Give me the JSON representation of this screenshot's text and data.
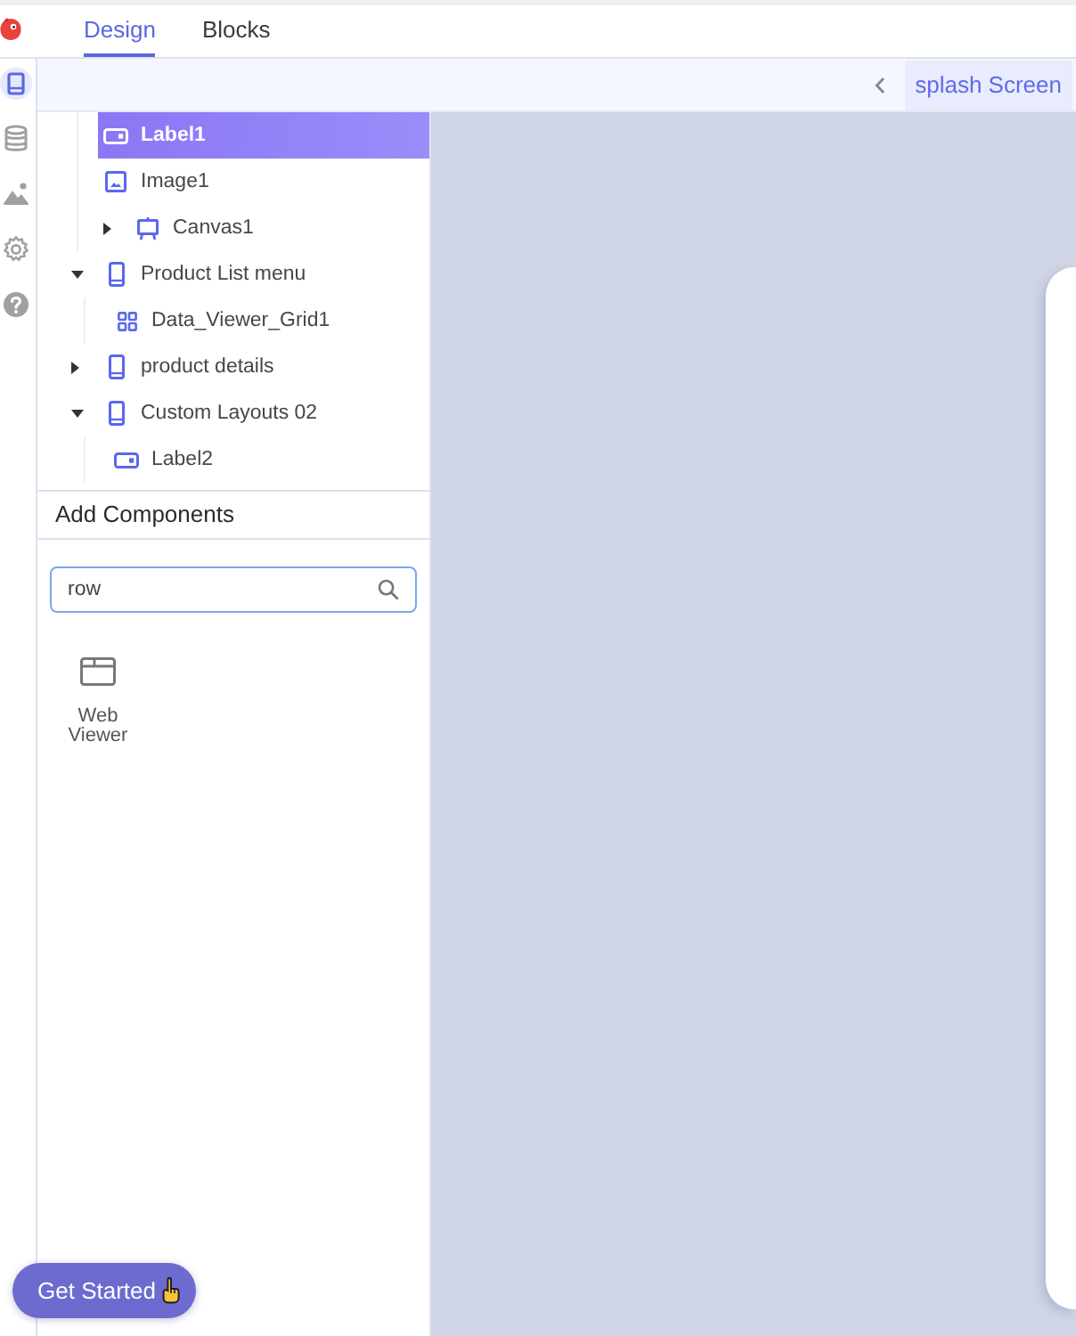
{
  "tabs": [
    {
      "label": "Design",
      "selected": true
    },
    {
      "label": "Blocks",
      "selected": false
    }
  ],
  "rail": [
    {
      "kind": "screens",
      "selected": true
    },
    {
      "kind": "data",
      "selected": false
    },
    {
      "kind": "media",
      "selected": false
    },
    {
      "kind": "settings",
      "selected": false
    },
    {
      "kind": "help",
      "selected": false
    }
  ],
  "current_screen": "splash Screen",
  "tree": {
    "hidden_parent_items": [
      {
        "label": "Label1",
        "kind": "label",
        "selected": true
      },
      {
        "label": "Image1",
        "kind": "image",
        "selected": false
      },
      {
        "label": "Canvas1",
        "kind": "canvas",
        "expanded": false,
        "selected": false
      }
    ],
    "screens": [
      {
        "label": "Product List menu",
        "kind": "screen",
        "expanded": true,
        "selected": false,
        "children": [
          {
            "label": "Data_Viewer_Grid1",
            "kind": "grid",
            "selected": false
          }
        ]
      },
      {
        "label": "product details",
        "kind": "screen",
        "expanded": false,
        "selected": false
      },
      {
        "label": "Custom Layouts 02",
        "kind": "screen",
        "expanded": true,
        "selected": false,
        "children": [
          {
            "label": "Label2",
            "kind": "label",
            "selected": false
          }
        ]
      }
    ]
  },
  "add_components": {
    "title": "Add Components",
    "search": {
      "value": "row"
    },
    "results": [
      {
        "label": "Web Viewer",
        "kind": "web_viewer"
      }
    ]
  },
  "get_started": {
    "label": "Get Started"
  }
}
